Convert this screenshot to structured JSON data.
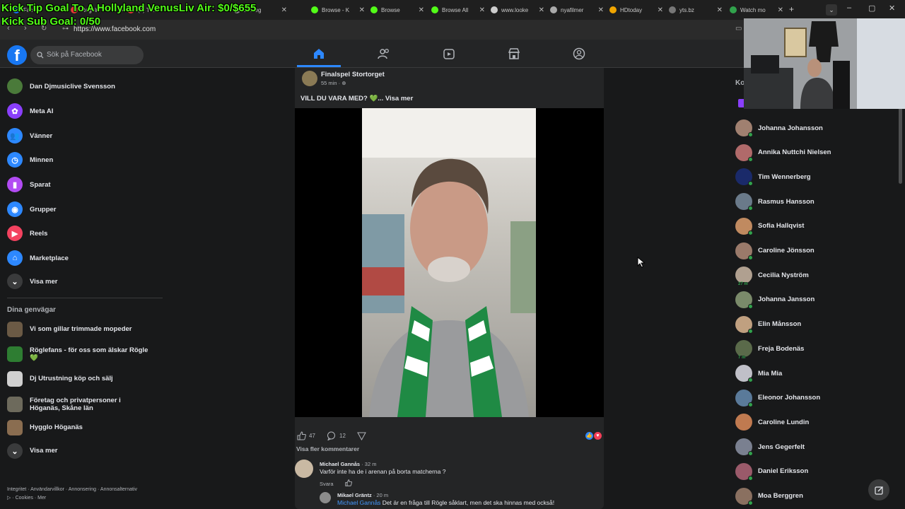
{
  "overlay": {
    "tip_goal": "Kick Tip Goal To A Hollyland VenusLiv Air: $0/$655",
    "sub_goal": "Kick Sub Goal: 0/50"
  },
  "browser": {
    "tabs": [
      {
        "label": "Face",
        "color": "#1877f2"
      },
      {
        "label": "Regeln",
        "color": "#e53935"
      },
      {
        "label": "(4) Tu...",
        "color": "#e53935"
      },
      {
        "label": "strateg",
        "color": "#888888"
      },
      {
        "label": "Browse - K",
        "color": "#53fc18"
      },
      {
        "label": "Browse",
        "color": "#53fc18"
      },
      {
        "label": "Browse All",
        "color": "#53fc18"
      },
      {
        "label": "www.looke",
        "color": "#cccccc"
      },
      {
        "label": "nyafilmer",
        "color": "#aaaaaa"
      },
      {
        "label": "HDtoday",
        "color": "#f0a500"
      },
      {
        "label": "yts.bz",
        "color": "#777777"
      },
      {
        "label": "Watch mo",
        "color": "#31a24c"
      }
    ],
    "url": "https://www.facebook.com"
  },
  "header": {
    "search_placeholder": "Sök på Facebook",
    "nav": [
      "home-icon",
      "friends-icon",
      "video-icon",
      "marketplace-icon",
      "groups-icon"
    ]
  },
  "left_nav": {
    "items": [
      {
        "label": "Dan Djmusiclive Svensson",
        "icon": "avatar",
        "color": "#4a7a3a"
      },
      {
        "label": "Meta AI",
        "icon": "meta-ai-icon",
        "color": "#8a3ffc"
      },
      {
        "label": "Vänner",
        "icon": "friends-icon",
        "color": "#2d88ff"
      },
      {
        "label": "Minnen",
        "icon": "clock-icon",
        "color": "#2d88ff"
      },
      {
        "label": "Sparat",
        "icon": "bookmark-icon",
        "color": "#b24bf3"
      },
      {
        "label": "Grupper",
        "icon": "groups-icon",
        "color": "#2d88ff"
      },
      {
        "label": "Reels",
        "icon": "reels-icon",
        "color": "#f3425f"
      },
      {
        "label": "Marketplace",
        "icon": "marketplace-icon",
        "color": "#2d88ff"
      },
      {
        "label": "Visa mer",
        "icon": "chevron-down-icon",
        "color": "#3a3b3c"
      }
    ],
    "shortcuts_title": "Dina genvägar",
    "shortcuts": [
      {
        "label": "Vi som gillar trimmade mopeder",
        "color": "#6b5a45"
      },
      {
        "label": "Röglefans - för oss som älskar Rögle 💚",
        "color": "#2e7d32"
      },
      {
        "label": "Dj Utrustning köp och sälj",
        "color": "#d0d0d0"
      },
      {
        "label": "Företag och privatpersoner i Höganäs, Skåne län",
        "color": "#6d6a5c"
      },
      {
        "label": "Hygglo Höganäs",
        "color": "#8a6d50"
      },
      {
        "label": "Visa mer",
        "color": "#3a3b3c"
      }
    ],
    "footer_line1": "Integritet · Användarvillkor · Annonsering · Annonsalternativ",
    "footer_line2": "▷ · Cookies · Mer"
  },
  "post": {
    "author": "Finalspel Stortorget",
    "time": "55 min · ",
    "text": "VILL DU VARA MED? 💚... Visa mer",
    "likes": "47",
    "comments": "12",
    "view_more_comments": "Visa fler kommentarer",
    "comment1": {
      "author": "Michael Gannås",
      "time": " · 32 m",
      "text": "Varför inte ha de i arenan på borta matcherna ?",
      "reply": "Svara"
    },
    "comment2": {
      "author": "Mikael Gräntz",
      "time": " · 20 m",
      "mention": "Michael Gannås",
      "text": " Det är en fråga till Rögle såklart, men det ska hinnas med också!"
    }
  },
  "contacts": {
    "header": "Ko",
    "list": [
      {
        "name": "Johanna Johansson",
        "color": "#a08070",
        "online": true,
        "badge": ""
      },
      {
        "name": "Annika Nuttchi Nielsen",
        "color": "#b06a6a",
        "online": true,
        "badge": ""
      },
      {
        "name": "Tim Wennerberg",
        "color": "#1a2a6a",
        "online": true,
        "badge": ""
      },
      {
        "name": "Rasmus Hansson",
        "color": "#6a7a8a",
        "online": true,
        "badge": ""
      },
      {
        "name": "Sofia Hallqvist",
        "color": "#c08a60",
        "online": true,
        "badge": ""
      },
      {
        "name": "Caroline Jönsson",
        "color": "#9a7a6a",
        "online": true,
        "badge": ""
      },
      {
        "name": "Cecilia Nyström",
        "color": "#b0a090",
        "online": false,
        "badge": "27 m"
      },
      {
        "name": "Johanna Jansson",
        "color": "#7a8a6a",
        "online": true,
        "badge": ""
      },
      {
        "name": "Elin Månsson",
        "color": "#c0a080",
        "online": true,
        "badge": ""
      },
      {
        "name": "Freja Bodenäs",
        "color": "#5a6a4a",
        "online": false,
        "badge": "7 m"
      },
      {
        "name": "Mia Mia",
        "color": "#c0c0c8",
        "online": true,
        "badge": ""
      },
      {
        "name": "Eleonor Johansson",
        "color": "#5a7a9a",
        "online": true,
        "badge": ""
      },
      {
        "name": "Caroline Lundin",
        "color": "#c07a50",
        "online": false,
        "badge": ""
      },
      {
        "name": "Jens Gegerfelt",
        "color": "#7a8090",
        "online": true,
        "badge": ""
      },
      {
        "name": "Daniel Eriksson",
        "color": "#9a5a6a",
        "online": true,
        "badge": ""
      },
      {
        "name": "Moa Berggren",
        "color": "#8a7060",
        "online": true,
        "badge": ""
      }
    ]
  }
}
